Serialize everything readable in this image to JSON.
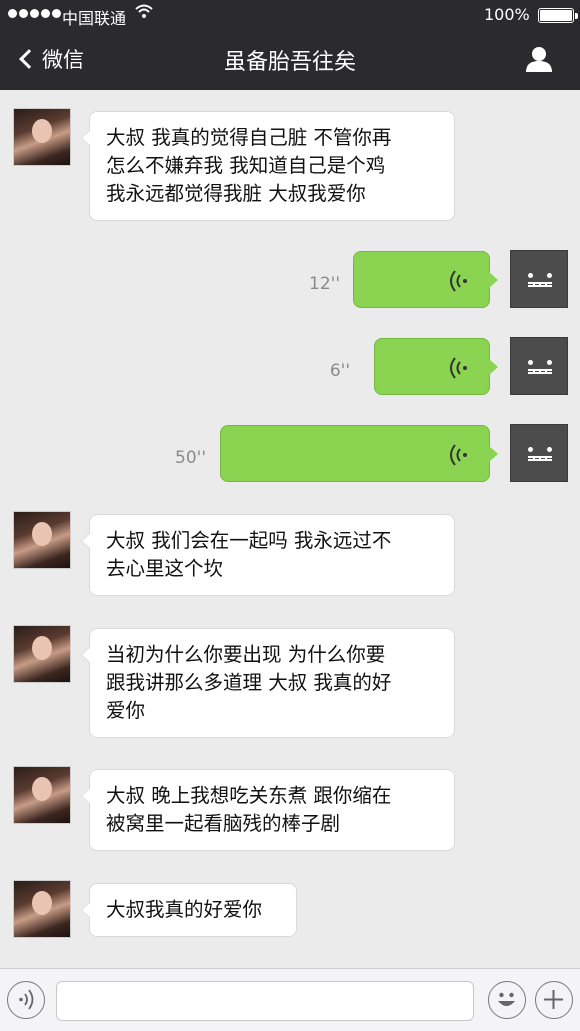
{
  "status_bar": {
    "carrier": "中国联通",
    "battery": "100%"
  },
  "nav": {
    "back_label": "微信",
    "title": "虽备胎吾往矣"
  },
  "messages": [
    {
      "from": "other",
      "text_lines": [
        "大叔 我真的觉得自己脏 不管你再",
        "怎么不嫌弃我 我知道自己是个鸡",
        "我永远都觉得我脏 大叔我爱你"
      ]
    },
    {
      "from": "self",
      "type": "voice",
      "duration": "12''"
    },
    {
      "from": "self",
      "type": "voice",
      "duration": "6''"
    },
    {
      "from": "self",
      "type": "voice",
      "duration": "50''"
    },
    {
      "from": "other",
      "text_lines": [
        "大叔 我们会在一起吗 我永远过不",
        "去心里这个坎"
      ]
    },
    {
      "from": "other",
      "text_lines": [
        "当初为什么你要出现 为什么你要",
        "跟我讲那么多道理 大叔 我真的好",
        "爱你"
      ]
    },
    {
      "from": "other",
      "text_lines": [
        "大叔 晚上我想吃关东煮 跟你缩在",
        "被窝里一起看脑残的棒子剧"
      ]
    },
    {
      "from": "other",
      "text_lines": [
        "大叔我真的好爱你"
      ]
    }
  ],
  "input_bar": {
    "voice_icon": "voice-mode-icon",
    "emoji_icon": "emoji-icon",
    "plus_icon": "plus-icon",
    "value": ""
  },
  "colors": {
    "nav_background": "#2b2b2d",
    "chat_background": "#ebebeb",
    "voice_bubble": "#8ad452"
  }
}
